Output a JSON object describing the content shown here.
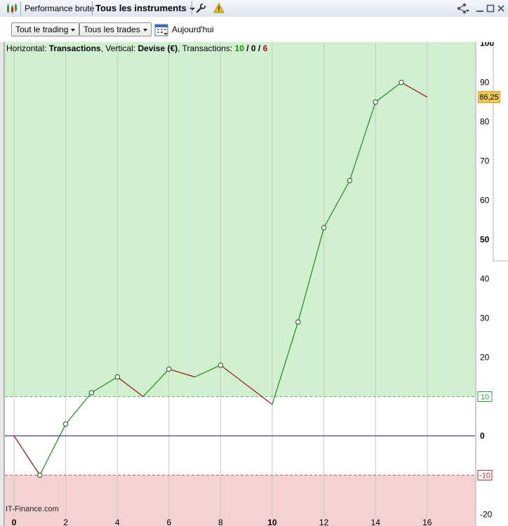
{
  "titlebar": {
    "title": "Performance brute",
    "instrument_select": "Tous les instruments",
    "icons": [
      "chart-icon",
      "wrench-icon",
      "warning-icon",
      "share-icon",
      "minimize-icon",
      "maximize-icon",
      "close-icon"
    ]
  },
  "toolbar": {
    "period_select": "Tout le trading",
    "trades_select": "Tous les trades",
    "today_label": "Aujourd'hui",
    "calendar_icon": "calendar-icon"
  },
  "info": {
    "horizontal_label": "Horizontal:",
    "horizontal_value": "Transactions",
    "vertical_label": ", Vertical:",
    "vertical_value": "Devise (€)",
    "transactions_label": ", Transactions:",
    "wins": "10",
    "sep1": " / ",
    "neutral": "0",
    "sep2": " / ",
    "losses": "6"
  },
  "watermark": "IT-Finance.com",
  "colors": {
    "gain_zone": "#d0f0d0",
    "loss_zone": "#f4d2d2",
    "up_segment": "#1a8a1a",
    "down_segment": "#9a1010",
    "zero_line": "#1e2a80",
    "price_tag": "#f2c94c"
  },
  "chart_data": {
    "type": "line",
    "x": [
      0,
      1,
      2,
      3,
      4,
      5,
      6,
      7,
      8,
      9,
      10,
      11,
      12,
      13,
      14,
      15,
      16
    ],
    "values": [
      0,
      -10,
      3,
      11,
      15,
      10,
      17,
      15,
      18,
      13,
      8,
      29,
      53,
      65,
      85,
      90,
      86.25
    ],
    "markers": [
      1,
      2,
      3,
      4,
      6,
      8,
      11,
      12,
      13,
      14,
      15
    ],
    "xlim": [
      -0.4,
      18
    ],
    "ylim": [
      -22,
      102
    ],
    "x_ticks": [
      "0",
      "2",
      "4",
      "6",
      "8",
      "10",
      "12",
      "14",
      "16"
    ],
    "x_tick_values": [
      0,
      2,
      4,
      6,
      8,
      10,
      12,
      14,
      16
    ],
    "x_bold_ticks": [
      0,
      10
    ],
    "y_ticks": [
      "100",
      "90",
      "80",
      "70",
      "60",
      "50",
      "40",
      "30",
      "20",
      "10",
      "0",
      "-10",
      "-20"
    ],
    "y_tick_values": [
      100,
      90,
      80,
      70,
      60,
      50,
      40,
      30,
      20,
      10,
      0,
      -10,
      -20
    ],
    "y_bold_ticks": [
      100,
      50,
      0
    ],
    "upper_threshold": 10,
    "lower_threshold": -10,
    "upper_threshold_label": "10",
    "lower_threshold_label": "-10",
    "last_value_label": "86,25",
    "grid": "vertical"
  }
}
